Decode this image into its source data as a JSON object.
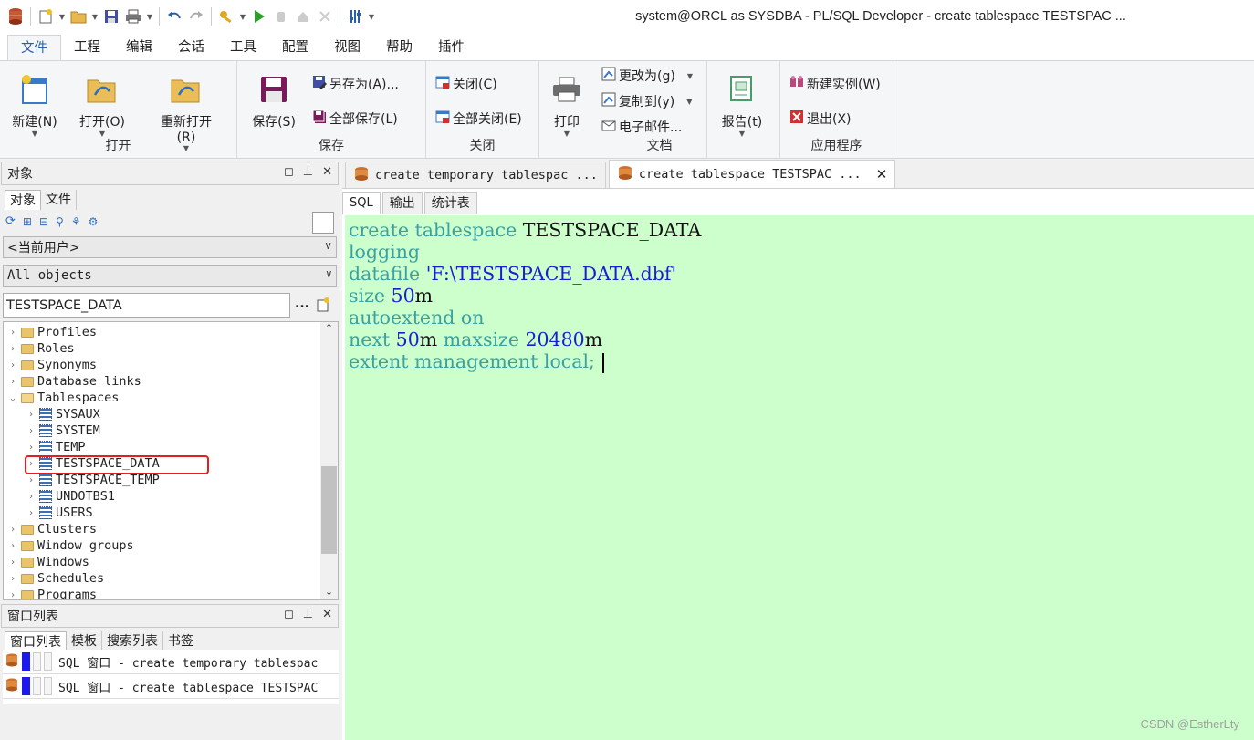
{
  "window": {
    "title": "system@ORCL as SYSDBA - PL/SQL Developer - create tablespace TESTSPAC ..."
  },
  "menu": {
    "tabs": [
      "文件",
      "工程",
      "编辑",
      "会话",
      "工具",
      "配置",
      "视图",
      "帮助",
      "插件"
    ]
  },
  "ribbon": {
    "open_group": {
      "label": "打开",
      "new": "新建(N)",
      "open": "打开(O)",
      "reopen": "重新打开(R)"
    },
    "save_group": {
      "label": "保存",
      "save": "保存(S)",
      "save_as": "另存为(A)...",
      "save_all": "全部保存(L)"
    },
    "close_group": {
      "label": "关闭",
      "close": "关闭(C)",
      "close_all": "全部关闭(E)"
    },
    "doc_group": {
      "label": "文档",
      "print": "打印",
      "change_to": "更改为(g)",
      "copy_to": "复制到(y)",
      "email": "电子邮件..."
    },
    "report_group": {
      "report": "报告(t)"
    },
    "app_group": {
      "label": "应用程序",
      "new_instance": "新建实例(W)",
      "exit": "退出(X)"
    }
  },
  "objects_panel": {
    "title": "对象",
    "tabs": [
      "对象",
      "文件"
    ],
    "user_select": "<当前用户>",
    "filter_select": "All objects",
    "search_value": "TESTSPACE_DATA",
    "search_more": "...",
    "tree": {
      "profiles": "Profiles",
      "roles": "Roles",
      "synonyms": "Synonyms",
      "database_links": "Database links",
      "tablespaces": "Tablespaces",
      "sysaux": "SYSAUX",
      "system": "SYSTEM",
      "temp": "TEMP",
      "testspace_data": "TESTSPACE_DATA",
      "testspace_temp": "TESTSPACE_TEMP",
      "undotbs1": "UNDOTBS1",
      "users": "USERS",
      "clusters": "Clusters",
      "window_groups": "Window groups",
      "windows": "Windows",
      "schedules": "Schedules",
      "programs": "Programs"
    }
  },
  "window_list_panel": {
    "title": "窗口列表",
    "tabs": [
      "窗口列表",
      "模板",
      "搜索列表",
      "书签"
    ],
    "items": [
      "SQL 窗口 - create temporary tablespac",
      "SQL 窗口 - create tablespace TESTSPAC"
    ]
  },
  "editor": {
    "doc_tabs": [
      "create temporary tablespac ...",
      "create tablespace TESTSPAC ..."
    ],
    "close_symbol": "✕",
    "tabs": [
      "SQL",
      "输出",
      "统计表"
    ],
    "code": {
      "l1_kw": "create tablespace",
      "l1_id": " TESTSPACE_DATA",
      "l2_kw": "logging",
      "l3_kw": "datafile",
      "l3_str": " 'F:\\TESTSPACE_DATA.dbf'",
      "l4_kw": "size",
      "l4_num": " 50",
      "l4_id": "m",
      "l5_kw": "autoextend on",
      "l6_kw": "next",
      "l6_num": " 50",
      "l6_id": "m",
      "l6_kw2": " maxsize",
      "l6_num2": " 20480",
      "l6_id2": "m",
      "l7_kw": "extent management local",
      "l7_id": ";"
    }
  },
  "watermark": "CSDN @EstherLty"
}
